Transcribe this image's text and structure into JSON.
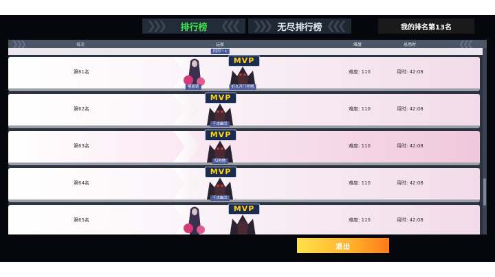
{
  "tabs": [
    {
      "label": "排行榜",
      "active": true
    },
    {
      "label": "无尽排行榜",
      "active": false
    }
  ],
  "my_rank": "我的排名第13名",
  "columns": {
    "rank": "名次",
    "player": "玩家",
    "difficulty": "难度",
    "time": "总用时"
  },
  "peek_name": "闪闪丶∧",
  "rows": [
    {
      "rank": "第61名",
      "players": [
        "嘻哥哥",
        "好久开门吧嗯"
      ],
      "difficulty": "难度: 110",
      "time": "用时: 42:08",
      "highlight": false
    },
    {
      "rank": "第62名",
      "players": [
        "千古幽兰"
      ],
      "difficulty": "难度: 110",
      "time": "用时: 42:08",
      "highlight": false
    },
    {
      "rank": "第63名",
      "players": [
        "扫地僧"
      ],
      "difficulty": "难度: 110",
      "time": "用时: 42:08",
      "highlight": true
    },
    {
      "rank": "第64名",
      "players": [
        "千古幽兰"
      ],
      "difficulty": "难度: 110",
      "time": "用时: 42:08",
      "highlight": false
    },
    {
      "rank": "第65名",
      "players": [],
      "difficulty": "难度: 110",
      "time": "用时: 42:08",
      "highlight": false
    }
  ],
  "mvp_label": "MVP",
  "exit_label": "退出",
  "colors": {
    "active_tab": "#3ce04a",
    "exit_start": "#ffe14a",
    "exit_end": "#ff7a18",
    "nametag": "#4b5a9a"
  }
}
